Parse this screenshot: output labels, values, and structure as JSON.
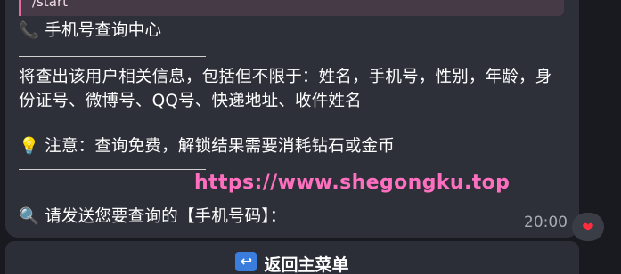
{
  "message": {
    "reply_quote": "/start",
    "title": "手机号查询中心",
    "desc_line1": "将查出该用户相关信息，包括但不限于：姓名，手机号，性别，年龄，身",
    "desc_line2": "份证号、微博号、QQ号、快递地址、收件姓名",
    "notice": "注意：查询免费，解锁结果需要消耗钻石或金币",
    "prompt": "请发送您要查询的【手机号码】：",
    "watermark": "https://www.shegongku.top",
    "time": "20:00"
  },
  "icons": {
    "title": "phone-icon",
    "notice": "lightbulb-icon",
    "prompt": "magnifier-icon",
    "reaction": "heart-icon",
    "button": "return-arrow-icon"
  },
  "reaction": "❤",
  "button": {
    "label": "返回主菜单"
  },
  "colors": {
    "bubble": "#2d3039",
    "quote_accent": "#e36a9a",
    "watermark": "#ff6fbf",
    "heart": "#ff2d3d"
  }
}
